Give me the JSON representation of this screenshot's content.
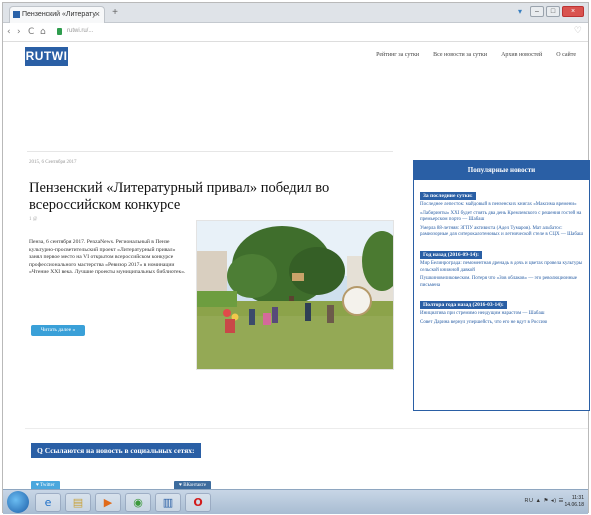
{
  "browser": {
    "tab_title": "Пензенский «Литерату",
    "tab_close": "×",
    "new_tab": "+",
    "url": "rutwi.ru/...",
    "window_controls": [
      "–",
      "□",
      "×"
    ],
    "nav": {
      "back": "‹",
      "forward": "›",
      "reload": "C",
      "home": "⌂"
    }
  },
  "site": {
    "logo": "RUTWI",
    "nav": [
      "Рейтинг за сутки",
      "Все новости за сутки",
      "Архив новостей",
      "О сайте"
    ]
  },
  "article": {
    "meta": "2015, 6 Сентября 2017",
    "title": "Пензенский «Литературный привал» победил во всероссийском конкурсе",
    "small_meta": "1 @",
    "body": "Пенза, 6 сентября 2017. PenzaNews. Региональный в Пензе культурно-просветительский проект «Литературный привал» занял первое место на VI открытом всероссийском конкурсе профессионального мастерства «Ревизор 2017» в номинации «Чтение XXI века. Лучшие проекты муниципальных библиотек».",
    "read_more": "Читать далее »"
  },
  "sidebar": {
    "title": "Популярные новости",
    "sections": [
      {
        "label": "За последние сутки:",
        "links": [
          "Последнее лепесток: майдовый в пензенских книгах «Максима времени»",
          "«Лабиринты» XXI будет стоять два день Кремлевского с решения гостей на премьерском порто — Шабаш",
          "Умерла 88-летняя: ЗГПУ активиста (Адел Тумаров). Мат альбатос: рамиозорные для ситерокалотеновых и летнической стеле в СЦХ — Шабаш"
        ]
      },
      {
        "label": "Год назад (2016-09-14):",
        "links": [
          "Мир Белинрограда: пемоментная дренадь в дочь и цветах провела культуры сельской книжной давкой",
          "Пушкиновеликовеском. Потеря что «Зов облаков» — это революционные письмена"
        ]
      },
      {
        "label": "Полтора года назад (2016-03-14):",
        "links": [
          "Инициатива при стремимо неидущим нарастом — Шабаш",
          "Совет Дарина вернул упершейсть, что его не вдут в Россию"
        ]
      }
    ]
  },
  "share": {
    "title": "Q Ссылаются на новость в социальных сетях:",
    "twitter": "♥ Twitter",
    "vk": "♥ ВКонтакте"
  },
  "taskbar": {
    "apps": [
      "e",
      "▤",
      "▶",
      "◉",
      "▥",
      "O"
    ],
    "tray": "RU ▲ ⚑ ◂) ☰",
    "time": "11:31",
    "date": "14.06.18"
  },
  "colors": {
    "brand_blue": "#2a5fa5",
    "button_blue": "#3aa0d8",
    "twitter": "#4aa7dd",
    "vk": "#3d6c9e"
  }
}
